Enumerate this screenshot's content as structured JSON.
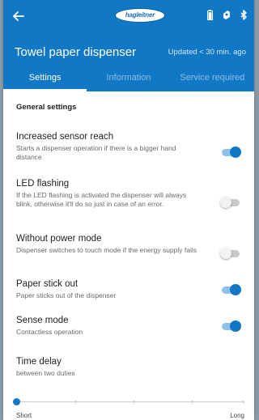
{
  "header": {
    "logo_text": "hagleitner",
    "status_icons": [
      "battery-icon",
      "paper-icon",
      "bluetooth-icon"
    ],
    "title": "Towel paper dispenser",
    "updated": "Updated < 30 min. ago"
  },
  "tabs": [
    {
      "label": "Settings",
      "active": true
    },
    {
      "label": "Information",
      "active": false
    },
    {
      "label": "Service required",
      "active": false
    }
  ],
  "section": {
    "title": "General settings"
  },
  "settings": [
    {
      "title": "Increased sensor reach",
      "description": "Starts a dispenser operation if there is a bigger hand distance",
      "enabled": true
    },
    {
      "title": "LED flashing",
      "description": "If the LED flashing is activated the dispenser will always blink, otherwise it'll do so just in case of an error.",
      "enabled": false
    },
    {
      "title": "Without power mode",
      "description": "Dispenser switches to touch mode if the energy supply fails",
      "enabled": false
    },
    {
      "title": "Paper stick out",
      "description": "Paper sticks out of the dispenser",
      "enabled": true
    },
    {
      "title": "Sense mode",
      "description": "Contactless operation",
      "enabled": true
    }
  ],
  "time_delay": {
    "title": "Time delay",
    "description": "between two duties",
    "min_label": "Short",
    "max_label": "Long",
    "value_fraction": 0
  },
  "colors": {
    "accent": "#1178c6"
  }
}
